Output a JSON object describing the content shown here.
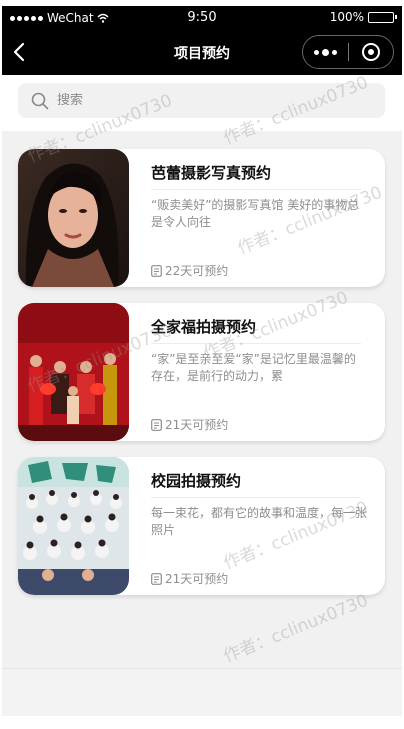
{
  "status_bar": {
    "carrier": "WeChat",
    "time": "9:50",
    "battery": "100%"
  },
  "nav": {
    "title": "项目预约"
  },
  "search": {
    "placeholder": "搜索"
  },
  "items": [
    {
      "title": "芭蕾摄影写真预约",
      "description": "“贩卖美好”的摄影写真馆 美好的事物总是令人向往",
      "availability": "22天可预约"
    },
    {
      "title": "全家福拍摄预约",
      "description": "“家”是至亲至爱“家”是记忆里最温馨的存在，是前行的动力，累",
      "availability": "21天可预约"
    },
    {
      "title": "校园拍摄预约",
      "description": "每一束花，都有它的故事和温度，每一张照片",
      "availability": "21天可预约"
    }
  ],
  "watermark_text": "作者：cclinux0730",
  "colors": {
    "header_bg": "#000000",
    "page_bg": "#f1f1f1",
    "card_bg": "#ffffff",
    "muted_text": "#8e8e8e"
  }
}
